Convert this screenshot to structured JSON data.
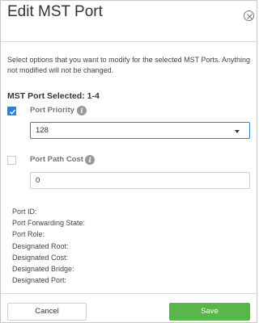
{
  "dialog": {
    "title": "Edit MST Port",
    "description": "Select options that you want to modify for the selected MST Ports. Anything not modified will not be changed.",
    "selected_label": "MST Port Selected: 1-4"
  },
  "fields": {
    "port_priority": {
      "label": "Port Priority",
      "checked": true,
      "value": "128"
    },
    "port_path_cost": {
      "label": "Port Path Cost",
      "checked": false,
      "value": "0"
    }
  },
  "info": [
    "Port ID:",
    "Port Forwarding State:",
    "Port Role:",
    "Designated Root:",
    "Designated Cost:",
    "Designated Bridge:",
    "Designated Port:"
  ],
  "footer": {
    "cancel_label": "Cancel",
    "save_label": "Save"
  },
  "colors": {
    "accent": "#2f80d1",
    "save": "#5ab54b"
  },
  "icons": {
    "info": "i"
  }
}
